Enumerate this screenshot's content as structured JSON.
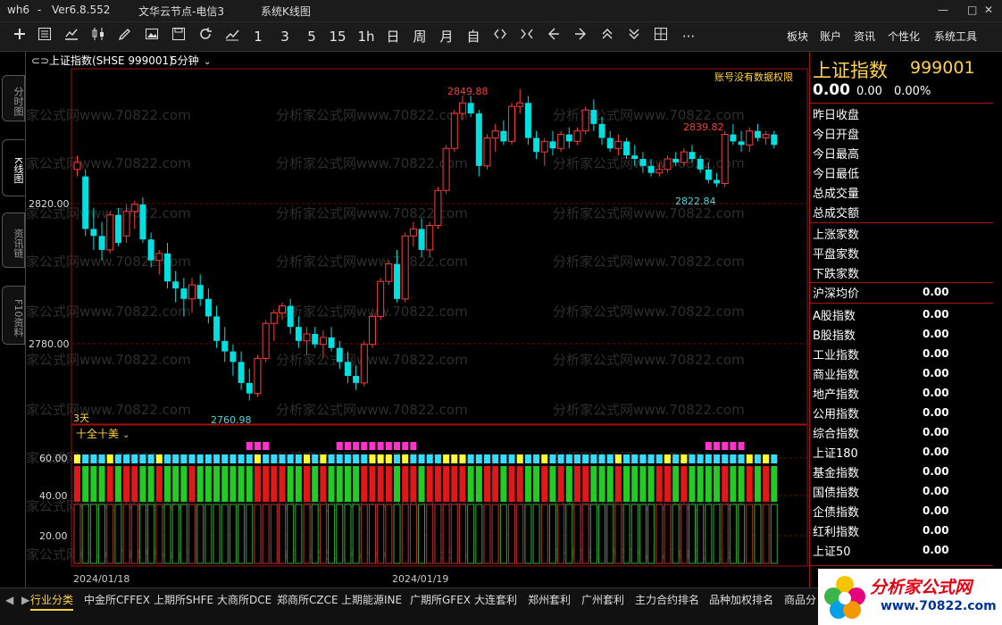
{
  "titlebar": {
    "user": "wh6",
    "separator": "-",
    "version": "Ver6.8.552",
    "server": "文华云节点-电信3",
    "mode": "系统K线图",
    "minimize": "—",
    "maximize": "□",
    "close": "✕"
  },
  "toolbar": {
    "periods": [
      "1",
      "3",
      "5",
      "15",
      "1h",
      "日",
      "周",
      "月",
      "自"
    ],
    "more": "···",
    "menus": [
      "板块",
      "账户",
      "资讯",
      "个性化",
      "系统工具"
    ]
  },
  "left_tabs": [
    "分时图",
    "K线图",
    "资讯链",
    "F10资料"
  ],
  "chart": {
    "header_title": "上证指数(SHSE 999001)",
    "period_label": "5分钟",
    "no_permission": "账号没有数据权限",
    "overlay_label": "3天",
    "y_ticks": [
      "2820.00",
      "2780.00"
    ],
    "high_label": "2849.88",
    "high2_label": "2839.82",
    "low_label": "2760.98",
    "low2_label": "2822.84",
    "indicator_name": "十全十美",
    "ind_y_ticks": [
      "60.00",
      "40.00",
      "20.00"
    ],
    "dates": [
      "2024/01/18",
      "2024/01/19"
    ],
    "watermark": "分析家公式网www.70822.com"
  },
  "chart_data": {
    "type": "candlestick",
    "ylim": [
      2755,
      2855
    ],
    "ohlc": [
      [
        2827,
        2831,
        2825,
        2829
      ],
      [
        2825,
        2827,
        2808,
        2810
      ],
      [
        2810,
        2816,
        2804,
        2808
      ],
      [
        2808,
        2812,
        2801,
        2804
      ],
      [
        2804,
        2815,
        2803,
        2814
      ],
      [
        2814,
        2816,
        2805,
        2806
      ],
      [
        2808,
        2817,
        2806,
        2815
      ],
      [
        2815,
        2818,
        2810,
        2817
      ],
      [
        2817,
        2819,
        2806,
        2807
      ],
      [
        2807,
        2809,
        2799,
        2801
      ],
      [
        2801,
        2804,
        2797,
        2803
      ],
      [
        2803,
        2806,
        2793,
        2795
      ],
      [
        2795,
        2798,
        2789,
        2793
      ],
      [
        2793,
        2796,
        2785,
        2790
      ],
      [
        2790,
        2796,
        2786,
        2794
      ],
      [
        2794,
        2797,
        2788,
        2790
      ],
      [
        2790,
        2793,
        2783,
        2785
      ],
      [
        2785,
        2788,
        2776,
        2778
      ],
      [
        2778,
        2782,
        2772,
        2775
      ],
      [
        2775,
        2777,
        2768,
        2772
      ],
      [
        2772,
        2775,
        2764,
        2766
      ],
      [
        2766,
        2770,
        2761,
        2763
      ],
      [
        2763,
        2774,
        2762,
        2773
      ],
      [
        2773,
        2784,
        2772,
        2783
      ],
      [
        2783,
        2787,
        2778,
        2786
      ],
      [
        2786,
        2789,
        2784,
        2788
      ],
      [
        2788,
        2790,
        2780,
        2782
      ],
      [
        2782,
        2785,
        2776,
        2778
      ],
      [
        2778,
        2782,
        2774,
        2780
      ],
      [
        2780,
        2782,
        2776,
        2777
      ],
      [
        2777,
        2781,
        2773,
        2779
      ],
      [
        2779,
        2782,
        2775,
        2776
      ],
      [
        2776,
        2778,
        2770,
        2772
      ],
      [
        2772,
        2775,
        2766,
        2768
      ],
      [
        2768,
        2771,
        2764,
        2766
      ],
      [
        2766,
        2778,
        2765,
        2777
      ],
      [
        2777,
        2786,
        2776,
        2785
      ],
      [
        2785,
        2796,
        2784,
        2795
      ],
      [
        2795,
        2801,
        2794,
        2800
      ],
      [
        2800,
        2804,
        2789,
        2790
      ],
      [
        2790,
        2809,
        2789,
        2808
      ],
      [
        2808,
        2812,
        2805,
        2810
      ],
      [
        2810,
        2813,
        2802,
        2804
      ],
      [
        2804,
        2812,
        2802,
        2811
      ],
      [
        2811,
        2822,
        2810,
        2821
      ],
      [
        2821,
        2834,
        2820,
        2833
      ],
      [
        2833,
        2844,
        2832,
        2843
      ],
      [
        2843,
        2848,
        2841,
        2846
      ],
      [
        2846,
        2848,
        2842,
        2843
      ],
      [
        2843,
        2844,
        2825,
        2828
      ],
      [
        2828,
        2837,
        2827,
        2836
      ],
      [
        2836,
        2840,
        2832,
        2838
      ],
      [
        2838,
        2841,
        2834,
        2835
      ],
      [
        2835,
        2846,
        2834,
        2845
      ],
      [
        2845,
        2850,
        2843,
        2846
      ],
      [
        2846,
        2848,
        2834,
        2836
      ],
      [
        2836,
        2838,
        2830,
        2832
      ],
      [
        2832,
        2836,
        2828,
        2835
      ],
      [
        2835,
        2838,
        2831,
        2833
      ],
      [
        2833,
        2838,
        2832,
        2837
      ],
      [
        2837,
        2839,
        2833,
        2835
      ],
      [
        2835,
        2839,
        2834,
        2838
      ],
      [
        2838,
        2845,
        2837,
        2844
      ],
      [
        2844,
        2847,
        2838,
        2840
      ],
      [
        2840,
        2842,
        2834,
        2836
      ],
      [
        2836,
        2838,
        2832,
        2833
      ],
      [
        2833,
        2837,
        2831,
        2835
      ],
      [
        2835,
        2836,
        2830,
        2831
      ],
      [
        2831,
        2834,
        2828,
        2830
      ],
      [
        2830,
        2832,
        2826,
        2828
      ],
      [
        2828,
        2830,
        2825,
        2826
      ],
      [
        2826,
        2829,
        2825,
        2827
      ],
      [
        2827,
        2831,
        2826,
        2830
      ],
      [
        2830,
        2832,
        2828,
        2829
      ],
      [
        2829,
        2833,
        2828,
        2832
      ],
      [
        2832,
        2834,
        2829,
        2830
      ],
      [
        2830,
        2831,
        2826,
        2827
      ],
      [
        2827,
        2829,
        2823,
        2824
      ],
      [
        2824,
        2826,
        2822,
        2823
      ],
      [
        2823,
        2838,
        2822,
        2837
      ],
      [
        2837,
        2840,
        2834,
        2835
      ],
      [
        2835,
        2838,
        2832,
        2834
      ],
      [
        2834,
        2839,
        2832,
        2838
      ],
      [
        2838,
        2840,
        2835,
        2836
      ],
      [
        2836,
        2838,
        2834,
        2837
      ],
      [
        2837,
        2838,
        2833,
        2834
      ]
    ],
    "indicator_ylim": [
      0,
      75
    ]
  },
  "right_panel": {
    "name": "上证指数",
    "code": "999001",
    "price": "0.00",
    "change": "0.00",
    "pct": "0.00%",
    "fields": [
      "昨日收盘",
      "今日开盘",
      "今日最高",
      "今日最低",
      "总成交量",
      "总成交额"
    ],
    "breadth": [
      "上涨家数",
      "平盘家数",
      "下跌家数"
    ],
    "avg": {
      "label": "沪深均价",
      "value": "0.00"
    },
    "indices": [
      {
        "label": "A股指数",
        "value": "0.00"
      },
      {
        "label": "B股指数",
        "value": "0.00"
      },
      {
        "label": "工业指数",
        "value": "0.00"
      },
      {
        "label": "商业指数",
        "value": "0.00"
      },
      {
        "label": "地产指数",
        "value": "0.00"
      },
      {
        "label": "公用指数",
        "value": "0.00"
      },
      {
        "label": "综合指数",
        "value": "0.00"
      },
      {
        "label": "上证180",
        "value": "0.00"
      },
      {
        "label": "基金指数",
        "value": "0.00"
      },
      {
        "label": "国债指数",
        "value": "0.00"
      },
      {
        "label": "企债指数",
        "value": "0.00"
      },
      {
        "label": "红利指数",
        "value": "0.00"
      },
      {
        "label": "上证50",
        "value": "0.00"
      }
    ]
  },
  "bottom_tabs": [
    "行业分类",
    "中金所CFFEX",
    "上期所SHFE",
    "大商所DCE",
    "郑商所CZCE",
    "上期能源INE",
    "广期所GFEX",
    "大连套利",
    "郑州套利",
    "广州套利",
    "主力合约排名",
    "品种加权排名",
    "商品分"
  ],
  "logo": {
    "name": "分析家公式网",
    "url": "www.70822.com"
  },
  "colors": {
    "up": "#ff3b3b",
    "down": "#00e0e0",
    "grid": "#a01010",
    "accent": "#ffd24a"
  }
}
